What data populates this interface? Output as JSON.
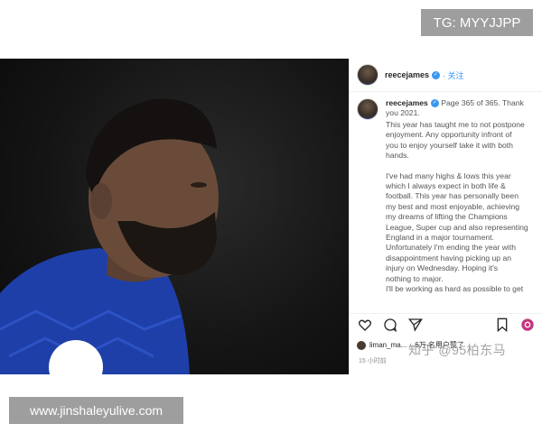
{
  "watermarks": {
    "tg": "TG: MYYJJPP",
    "site": "www.jinshaleyulive.com",
    "zhihu": "知乎 @95柏东马"
  },
  "header": {
    "username": "reecejames",
    "follow": "· 关注"
  },
  "caption": {
    "username": "reecejames",
    "intro": "Page 365 of 365. Thank you 2021.",
    "paragraph1": [
      "This year has taught me to not postpone",
      "enjoyment. Any opportunity infront of",
      "you to enjoy yourself take it with both",
      "hands."
    ],
    "paragraph2": [
      "I've had many highs & lows this year",
      "which I always expect in both life &",
      "football. This year has personally been",
      "my best and most enjoyable, achieving",
      "my dreams of lifting the Champions",
      "League, Super cup and also representing",
      "England in a major tournament.",
      "Unfortunately I'm ending the year with",
      "disappointment having picking up an",
      "injury on Wednesday. Hoping it's",
      "nothing to major.",
      "I'll be working as hard as possible to get"
    ]
  },
  "likes": {
    "text": "liman_ma...  ...6万 名用户赞了"
  },
  "timestamp": "15 小时前",
  "icons": {
    "like": "heart-icon",
    "comment": "comment-icon",
    "share": "send-icon",
    "save": "bookmark-icon"
  },
  "colors": {
    "jersey": "#1e3fa8",
    "verified": "#3897f0",
    "background_dark": "#111111"
  }
}
